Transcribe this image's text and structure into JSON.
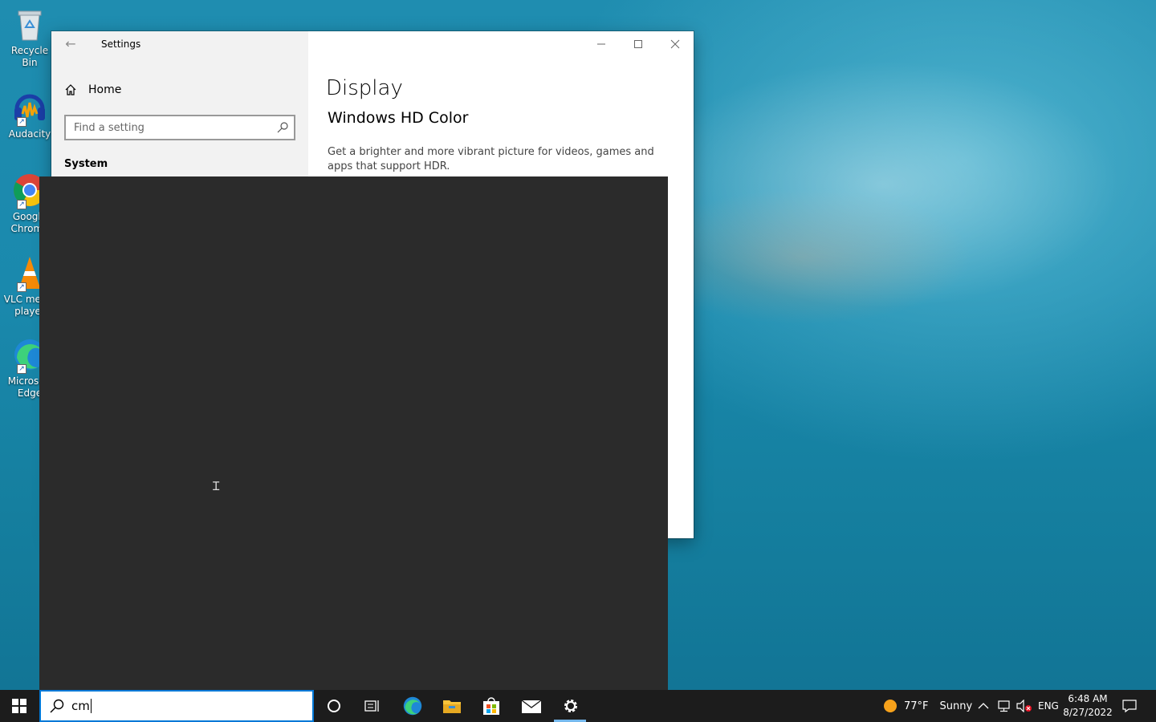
{
  "desktop": {
    "icons": [
      {
        "label": "Recycle Bin",
        "icon": "recycle-bin-icon"
      },
      {
        "label": "Audacity",
        "icon": "audacity-icon"
      },
      {
        "label": "Google Chrome",
        "icon": "chrome-icon"
      },
      {
        "label": "VLC media player",
        "icon": "vlc-icon"
      },
      {
        "label": "Microsoft Edge",
        "icon": "edge-icon"
      }
    ]
  },
  "settings": {
    "title": "Settings",
    "nav": {
      "home_label": "Home",
      "search_placeholder": "Find a setting",
      "section_label": "System"
    },
    "content": {
      "page_title": "Display",
      "section_title": "Windows HD Color",
      "description": "Get a brighter and more vibrant picture for videos, games and apps that support HDR."
    }
  },
  "taskbar": {
    "search_value": "cm",
    "apps": [
      "cortana-icon",
      "task-view-icon",
      "edge-icon",
      "file-explorer-icon",
      "store-icon",
      "mail-icon",
      "settings-gear-icon"
    ],
    "weather": {
      "temp": "77°F",
      "condition": "Sunny"
    },
    "language": "ENG",
    "time": "6:48 AM",
    "date": "8/27/2022"
  },
  "colors": {
    "taskbar_bg": "#1c1c1c",
    "flyout_bg": "#2b2b2b",
    "accent": "#0078d7"
  }
}
